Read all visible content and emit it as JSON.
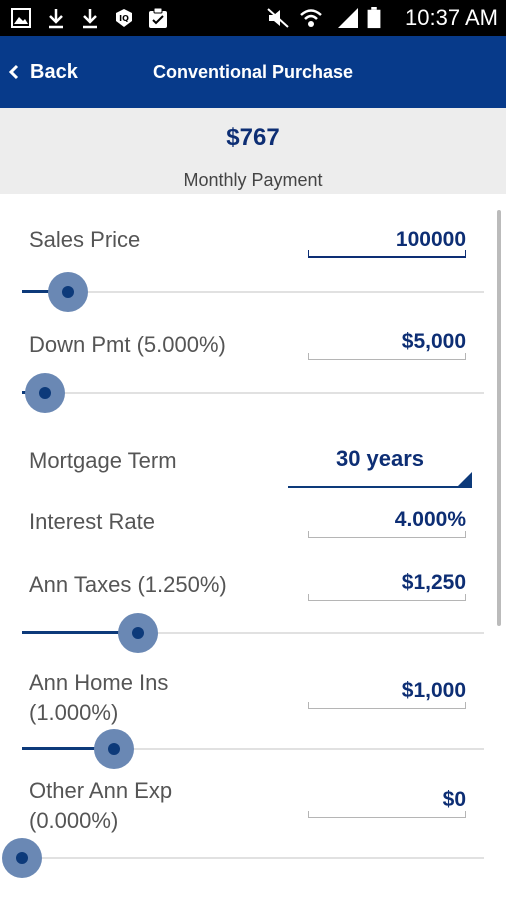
{
  "status_bar": {
    "time": "10:37 AM",
    "icons": [
      "gallery-icon",
      "download-icon",
      "download-icon",
      "iq-icon",
      "clipboard-icon",
      "mute-icon",
      "wifi-icon",
      "signal-icon",
      "battery-icon"
    ]
  },
  "header": {
    "back_label": "Back",
    "title": "Conventional Purchase"
  },
  "summary": {
    "amount": "$767",
    "label": "Monthly Payment"
  },
  "fields": {
    "sales_price": {
      "label": "Sales Price",
      "value": "100000",
      "slider_level": 0.1
    },
    "down_pmt": {
      "label": "Down Pmt (5.000%)",
      "value": "$5,000",
      "slider_level": 0.05
    },
    "mortgage_term": {
      "label": "Mortgage Term",
      "value": "30 years"
    },
    "interest_rate": {
      "label": "Interest Rate",
      "value": "4.000%"
    },
    "ann_taxes": {
      "label": "Ann Taxes (1.250%)",
      "value": "$1,250",
      "slider_level": 0.25
    },
    "ann_home_ins": {
      "label_line1": "Ann Home Ins",
      "label_line2": "(1.000%)",
      "value": "$1,000",
      "slider_level": 0.2
    },
    "other_ann_exp": {
      "label_line1": "Other Ann Exp",
      "label_line2": "(0.000%)",
      "value": "$0",
      "slider_level": 0.0
    }
  },
  "colors": {
    "app_bar": "#073a8a",
    "accent": "#0d2e74",
    "summary_bg": "#ededed"
  }
}
